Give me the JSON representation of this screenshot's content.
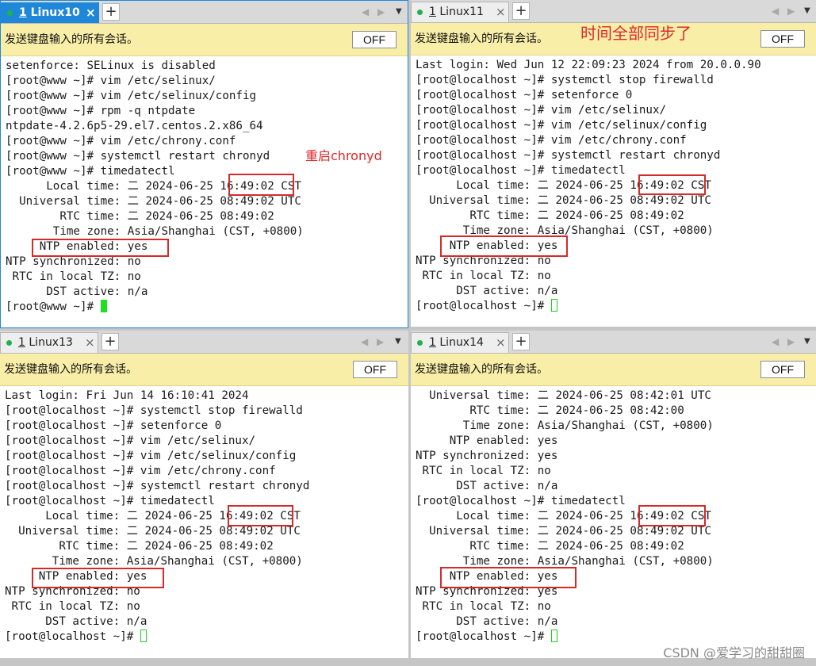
{
  "notice_text": "发送键盘输入的所有会话。",
  "off_label": "OFF",
  "plus_label": "+",
  "close_label": "×",
  "nav_prev": "◀",
  "nav_next": "▶",
  "nav_menu": "▼",
  "watermark": "CSDN @爱学习的甜甜圈",
  "panes": [
    {
      "tab_number": "1",
      "tab_name": "Linux10",
      "active": true,
      "note": "重启chronyd",
      "cursor": "filled",
      "lines": [
        "setenforce: SELinux is disabled",
        "[root@www ~]# vim /etc/selinux/",
        "[root@www ~]# vim /etc/selinux/config",
        "[root@www ~]# rpm -q ntpdate",
        "ntpdate-4.2.6p5-29.el7.centos.2.x86_64",
        "[root@www ~]# vim /etc/chrony.conf",
        "[root@www ~]# systemctl restart chronyd",
        "[root@www ~]# timedatectl",
        "      Local time: 二 2024-06-25 16:49:02 CST",
        "  Universal time: 二 2024-06-25 08:49:02 UTC",
        "        RTC time: 二 2024-06-25 08:49:02",
        "       Time zone: Asia/Shanghai (CST, +0800)",
        "     NTP enabled: yes",
        "NTP synchronized: no",
        " RTC in local TZ: no",
        "      DST active: n/a",
        "[root@www ~]# "
      ]
    },
    {
      "tab_number": "1",
      "tab_name": "Linux11",
      "active": false,
      "note": "时间全部同步了",
      "cursor": "hollow",
      "lines": [
        "Last login: Wed Jun 12 22:09:23 2024 from 20.0.0.90",
        "[root@localhost ~]# systemctl stop firewalld",
        "[root@localhost ~]# setenforce 0",
        "[root@localhost ~]# vim /etc/selinux/",
        "[root@localhost ~]# vim /etc/selinux/config",
        "[root@localhost ~]# vim /etc/chrony.conf",
        "[root@localhost ~]# systemctl restart chronyd",
        "[root@localhost ~]# timedatectl",
        "      Local time: 二 2024-06-25 16:49:02 CST",
        "  Universal time: 二 2024-06-25 08:49:02 UTC",
        "        RTC time: 二 2024-06-25 08:49:02",
        "       Time zone: Asia/Shanghai (CST, +0800)",
        "     NTP enabled: yes",
        "NTP synchronized: no",
        " RTC in local TZ: no",
        "      DST active: n/a",
        "[root@localhost ~]# "
      ]
    },
    {
      "tab_number": "1",
      "tab_name": "Linux13",
      "active": false,
      "note": "",
      "cursor": "hollow",
      "lines": [
        "Last login: Fri Jun 14 16:10:41 2024",
        "[root@localhost ~]# systemctl stop firewalld",
        "[root@localhost ~]# setenforce 0",
        "[root@localhost ~]# vim /etc/selinux/",
        "[root@localhost ~]# vim /etc/selinux/config",
        "[root@localhost ~]# vim /etc/chrony.conf",
        "[root@localhost ~]# systemctl restart chronyd",
        "[root@localhost ~]# timedatectl",
        "      Local time: 二 2024-06-25 16:49:02 CST",
        "  Universal time: 二 2024-06-25 08:49:02 UTC",
        "        RTC time: 二 2024-06-25 08:49:02",
        "       Time zone: Asia/Shanghai (CST, +0800)",
        "     NTP enabled: yes",
        "NTP synchronized: no",
        " RTC in local TZ: no",
        "      DST active: n/a",
        "[root@localhost ~]# "
      ]
    },
    {
      "tab_number": "1",
      "tab_name": "Linux14",
      "active": false,
      "note": "",
      "cursor": "hollow",
      "lines": [
        "  Universal time: 二 2024-06-25 08:42:01 UTC",
        "        RTC time: 二 2024-06-25 08:42:00",
        "       Time zone: Asia/Shanghai (CST, +0800)",
        "     NTP enabled: yes",
        "NTP synchronized: yes",
        " RTC in local TZ: no",
        "      DST active: n/a",
        "[root@localhost ~]# timedatectl",
        "      Local time: 二 2024-06-25 16:49:02 CST",
        "  Universal time: 二 2024-06-25 08:49:02 UTC",
        "        RTC time: 二 2024-06-25 08:49:02",
        "       Time zone: Asia/Shanghai (CST, +0800)",
        "     NTP enabled: yes",
        "NTP synchronized: yes",
        " RTC in local TZ: no",
        "      DST active: n/a",
        "[root@localhost ~]# "
      ]
    }
  ]
}
